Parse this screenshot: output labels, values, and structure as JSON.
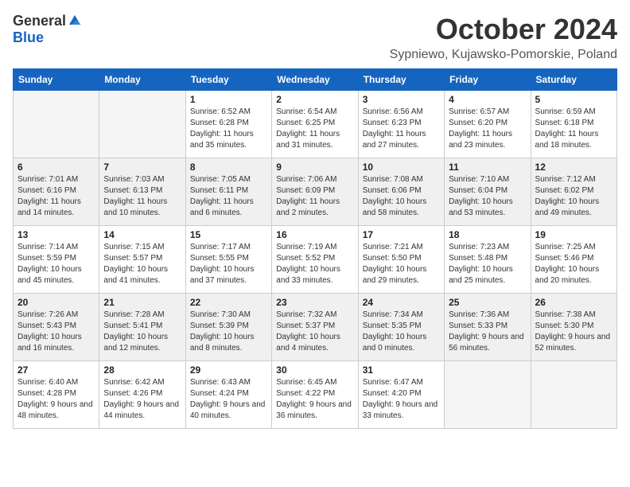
{
  "header": {
    "logo_general": "General",
    "logo_blue": "Blue",
    "title": "October 2024",
    "location": "Sypniewo, Kujawsko-Pomorskie, Poland"
  },
  "days_of_week": [
    "Sunday",
    "Monday",
    "Tuesday",
    "Wednesday",
    "Thursday",
    "Friday",
    "Saturday"
  ],
  "weeks": [
    [
      {
        "day": "",
        "sunrise": "",
        "sunset": "",
        "daylight": "",
        "empty": true
      },
      {
        "day": "",
        "sunrise": "",
        "sunset": "",
        "daylight": "",
        "empty": true
      },
      {
        "day": "1",
        "sunrise": "Sunrise: 6:52 AM",
        "sunset": "Sunset: 6:28 PM",
        "daylight": "Daylight: 11 hours and 35 minutes."
      },
      {
        "day": "2",
        "sunrise": "Sunrise: 6:54 AM",
        "sunset": "Sunset: 6:25 PM",
        "daylight": "Daylight: 11 hours and 31 minutes."
      },
      {
        "day": "3",
        "sunrise": "Sunrise: 6:56 AM",
        "sunset": "Sunset: 6:23 PM",
        "daylight": "Daylight: 11 hours and 27 minutes."
      },
      {
        "day": "4",
        "sunrise": "Sunrise: 6:57 AM",
        "sunset": "Sunset: 6:20 PM",
        "daylight": "Daylight: 11 hours and 23 minutes."
      },
      {
        "day": "5",
        "sunrise": "Sunrise: 6:59 AM",
        "sunset": "Sunset: 6:18 PM",
        "daylight": "Daylight: 11 hours and 18 minutes."
      }
    ],
    [
      {
        "day": "6",
        "sunrise": "Sunrise: 7:01 AM",
        "sunset": "Sunset: 6:16 PM",
        "daylight": "Daylight: 11 hours and 14 minutes."
      },
      {
        "day": "7",
        "sunrise": "Sunrise: 7:03 AM",
        "sunset": "Sunset: 6:13 PM",
        "daylight": "Daylight: 11 hours and 10 minutes."
      },
      {
        "day": "8",
        "sunrise": "Sunrise: 7:05 AM",
        "sunset": "Sunset: 6:11 PM",
        "daylight": "Daylight: 11 hours and 6 minutes."
      },
      {
        "day": "9",
        "sunrise": "Sunrise: 7:06 AM",
        "sunset": "Sunset: 6:09 PM",
        "daylight": "Daylight: 11 hours and 2 minutes."
      },
      {
        "day": "10",
        "sunrise": "Sunrise: 7:08 AM",
        "sunset": "Sunset: 6:06 PM",
        "daylight": "Daylight: 10 hours and 58 minutes."
      },
      {
        "day": "11",
        "sunrise": "Sunrise: 7:10 AM",
        "sunset": "Sunset: 6:04 PM",
        "daylight": "Daylight: 10 hours and 53 minutes."
      },
      {
        "day": "12",
        "sunrise": "Sunrise: 7:12 AM",
        "sunset": "Sunset: 6:02 PM",
        "daylight": "Daylight: 10 hours and 49 minutes."
      }
    ],
    [
      {
        "day": "13",
        "sunrise": "Sunrise: 7:14 AM",
        "sunset": "Sunset: 5:59 PM",
        "daylight": "Daylight: 10 hours and 45 minutes."
      },
      {
        "day": "14",
        "sunrise": "Sunrise: 7:15 AM",
        "sunset": "Sunset: 5:57 PM",
        "daylight": "Daylight: 10 hours and 41 minutes."
      },
      {
        "day": "15",
        "sunrise": "Sunrise: 7:17 AM",
        "sunset": "Sunset: 5:55 PM",
        "daylight": "Daylight: 10 hours and 37 minutes."
      },
      {
        "day": "16",
        "sunrise": "Sunrise: 7:19 AM",
        "sunset": "Sunset: 5:52 PM",
        "daylight": "Daylight: 10 hours and 33 minutes."
      },
      {
        "day": "17",
        "sunrise": "Sunrise: 7:21 AM",
        "sunset": "Sunset: 5:50 PM",
        "daylight": "Daylight: 10 hours and 29 minutes."
      },
      {
        "day": "18",
        "sunrise": "Sunrise: 7:23 AM",
        "sunset": "Sunset: 5:48 PM",
        "daylight": "Daylight: 10 hours and 25 minutes."
      },
      {
        "day": "19",
        "sunrise": "Sunrise: 7:25 AM",
        "sunset": "Sunset: 5:46 PM",
        "daylight": "Daylight: 10 hours and 20 minutes."
      }
    ],
    [
      {
        "day": "20",
        "sunrise": "Sunrise: 7:26 AM",
        "sunset": "Sunset: 5:43 PM",
        "daylight": "Daylight: 10 hours and 16 minutes."
      },
      {
        "day": "21",
        "sunrise": "Sunrise: 7:28 AM",
        "sunset": "Sunset: 5:41 PM",
        "daylight": "Daylight: 10 hours and 12 minutes."
      },
      {
        "day": "22",
        "sunrise": "Sunrise: 7:30 AM",
        "sunset": "Sunset: 5:39 PM",
        "daylight": "Daylight: 10 hours and 8 minutes."
      },
      {
        "day": "23",
        "sunrise": "Sunrise: 7:32 AM",
        "sunset": "Sunset: 5:37 PM",
        "daylight": "Daylight: 10 hours and 4 minutes."
      },
      {
        "day": "24",
        "sunrise": "Sunrise: 7:34 AM",
        "sunset": "Sunset: 5:35 PM",
        "daylight": "Daylight: 10 hours and 0 minutes."
      },
      {
        "day": "25",
        "sunrise": "Sunrise: 7:36 AM",
        "sunset": "Sunset: 5:33 PM",
        "daylight": "Daylight: 9 hours and 56 minutes."
      },
      {
        "day": "26",
        "sunrise": "Sunrise: 7:38 AM",
        "sunset": "Sunset: 5:30 PM",
        "daylight": "Daylight: 9 hours and 52 minutes."
      }
    ],
    [
      {
        "day": "27",
        "sunrise": "Sunrise: 6:40 AM",
        "sunset": "Sunset: 4:28 PM",
        "daylight": "Daylight: 9 hours and 48 minutes."
      },
      {
        "day": "28",
        "sunrise": "Sunrise: 6:42 AM",
        "sunset": "Sunset: 4:26 PM",
        "daylight": "Daylight: 9 hours and 44 minutes."
      },
      {
        "day": "29",
        "sunrise": "Sunrise: 6:43 AM",
        "sunset": "Sunset: 4:24 PM",
        "daylight": "Daylight: 9 hours and 40 minutes."
      },
      {
        "day": "30",
        "sunrise": "Sunrise: 6:45 AM",
        "sunset": "Sunset: 4:22 PM",
        "daylight": "Daylight: 9 hours and 36 minutes."
      },
      {
        "day": "31",
        "sunrise": "Sunrise: 6:47 AM",
        "sunset": "Sunset: 4:20 PM",
        "daylight": "Daylight: 9 hours and 33 minutes."
      },
      {
        "day": "",
        "sunrise": "",
        "sunset": "",
        "daylight": "",
        "empty": true
      },
      {
        "day": "",
        "sunrise": "",
        "sunset": "",
        "daylight": "",
        "empty": true
      }
    ]
  ]
}
